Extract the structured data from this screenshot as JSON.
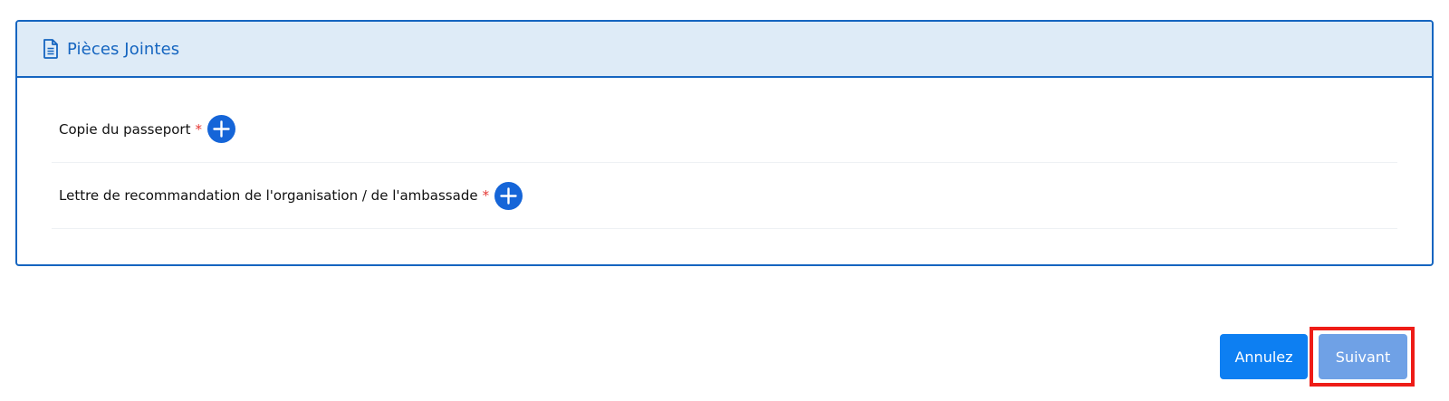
{
  "panel": {
    "title": "Pièces Jointes",
    "icon": "document-icon"
  },
  "attachments": [
    {
      "label": "Copie du passeport",
      "required_mark": "*",
      "add_icon": "plus-circle-icon"
    },
    {
      "label": "Lettre de recommandation de l'organisation / de l'ambassade",
      "required_mark": "*",
      "add_icon": "plus-circle-icon"
    }
  ],
  "actions": {
    "cancel_label": "Annulez",
    "next_label": "Suivant"
  },
  "colors": {
    "accent": "#1565c0",
    "header_bg": "#deebf7",
    "required": "#e53935",
    "cancel_button": "#0d7ff2",
    "next_button": "#6fa1e6",
    "highlight": "#ee1c17"
  }
}
